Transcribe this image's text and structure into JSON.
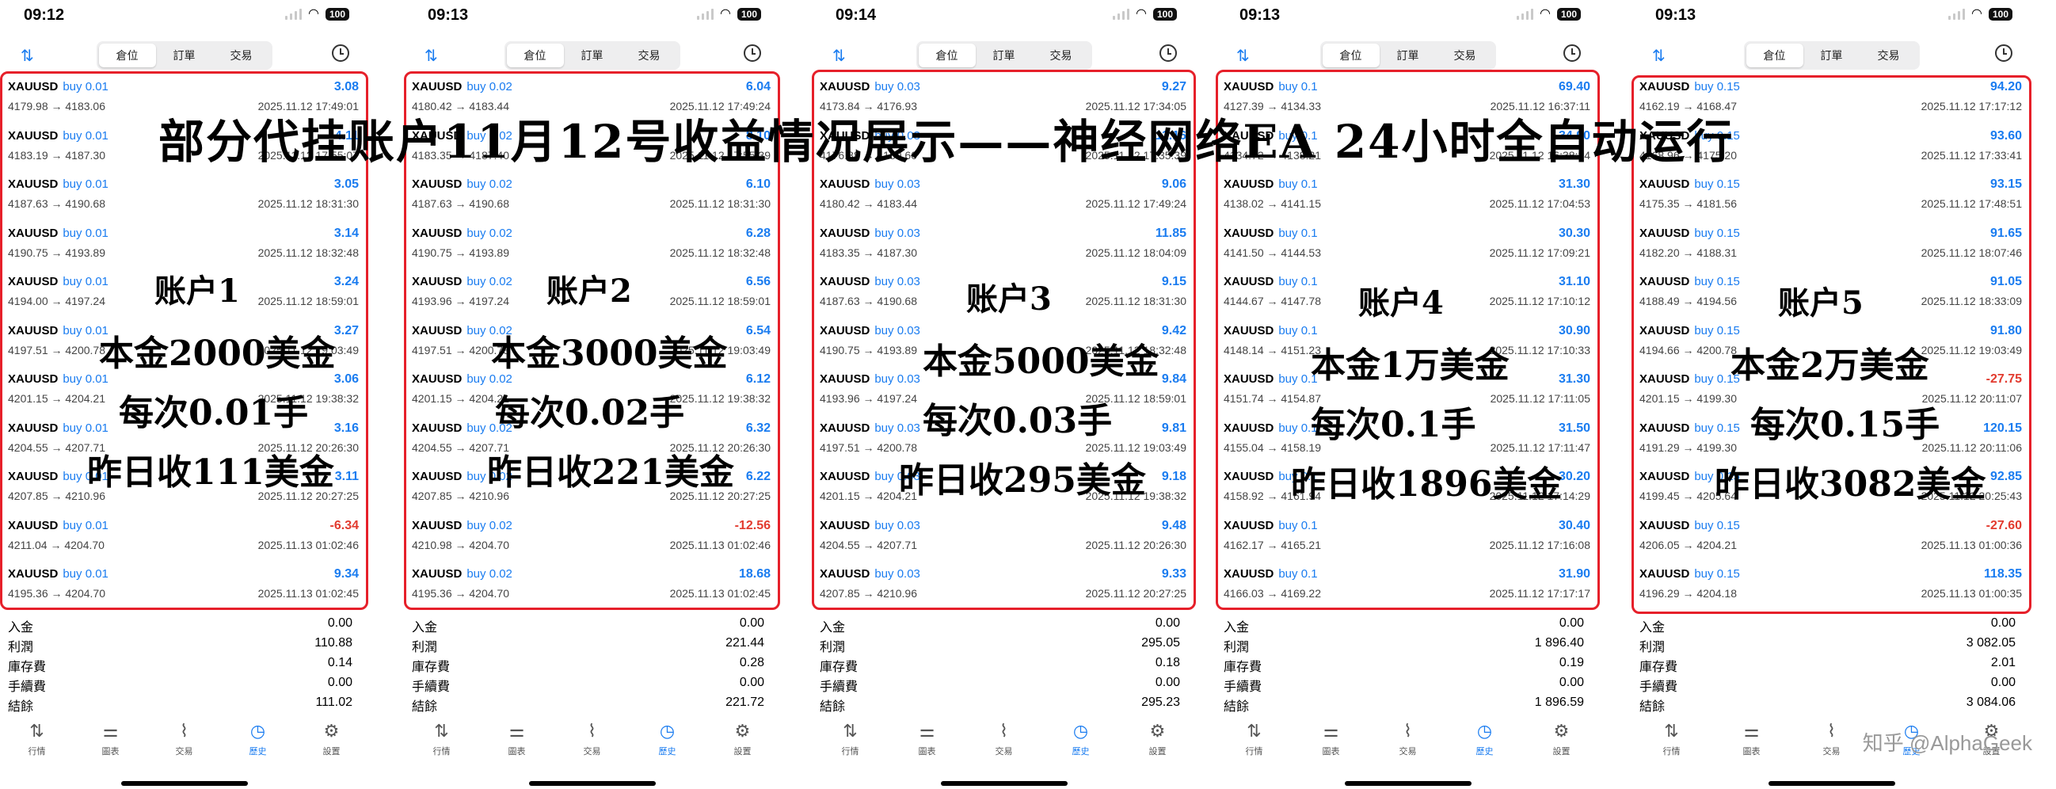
{
  "overlay_title": "部分代挂账户11月12号收益情况展示——神经网络EA 24小时全自动运行",
  "watermark": "知乎 @AlphaGeek",
  "segment_tabs": [
    "倉位",
    "訂單",
    "交易"
  ],
  "bottom_tabs": [
    {
      "label": "行情",
      "icon": "quotes-icon",
      "glyph": "⇅"
    },
    {
      "label": "圖表",
      "icon": "chart-icon",
      "glyph": "⚌"
    },
    {
      "label": "交易",
      "icon": "trade-icon",
      "glyph": "⌇"
    },
    {
      "label": "歷史",
      "icon": "history-icon",
      "glyph": "◷"
    },
    {
      "label": "設置",
      "icon": "settings-icon",
      "glyph": "⚙"
    }
  ],
  "summary_labels": {
    "deposit": "入金",
    "profit": "利潤",
    "swap": "庫存費",
    "commission": "手續費",
    "balance": "結餘"
  },
  "colors": {
    "buy": "#1a7cf0",
    "negative": "#e23b2f",
    "highlight": "#e6202a"
  },
  "screens": [
    {
      "time": "09:12",
      "battery": "100",
      "symbol": "XAUUSD",
      "side": "buy 0.01",
      "notes": {
        "account": "账户1",
        "capital": "本金2000美金",
        "lot": "每次0.01手",
        "yesterday": "昨日收111美金"
      },
      "trades": [
        {
          "price": "4179.98 → 4183.06",
          "profit": "3.08",
          "time": "2025.11.12 17:49:01"
        },
        {
          "price": "4183.19 → 4187.30",
          "profit": "4.11",
          "time": "2025.11.12 17:55:07"
        },
        {
          "price": "4187.63 → 4190.68",
          "profit": "3.05",
          "time": "2025.11.12 18:31:30"
        },
        {
          "price": "4190.75 → 4193.89",
          "profit": "3.14",
          "time": "2025.11.12 18:32:48"
        },
        {
          "price": "4194.00 → 4197.24",
          "profit": "3.24",
          "time": "2025.11.12 18:59:01"
        },
        {
          "price": "4197.51 → 4200.78",
          "profit": "3.27",
          "time": "2025.11.12 19:03:49"
        },
        {
          "price": "4201.15 → 4204.21",
          "profit": "3.06",
          "time": "2025.11.12 19:38:32"
        },
        {
          "price": "4204.55 → 4207.71",
          "profit": "3.16",
          "time": "2025.11.12 20:26:30"
        },
        {
          "price": "4207.85 → 4210.96",
          "profit": "3.11",
          "time": "2025.11.12 20:27:25"
        },
        {
          "price": "4211.04 → 4204.70",
          "profit": "-6.34",
          "time": "2025.11.13 01:02:46"
        },
        {
          "price": "4195.36 → 4204.70",
          "profit": "9.34",
          "time": "2025.11.13 01:02:45"
        }
      ],
      "summary": {
        "deposit": "0.00",
        "profit": "110.88",
        "swap": "0.14",
        "commission": "0.00",
        "balance": "111.02"
      }
    },
    {
      "time": "09:13",
      "battery": "100",
      "symbol": "XAUUSD",
      "side": "buy 0.02",
      "notes": {
        "account": "账户2",
        "capital": "本金3000美金",
        "lot": "每次0.02手",
        "yesterday": "昨日收221美金"
      },
      "trades": [
        {
          "price": "4180.42 → 4183.44",
          "profit": "6.04",
          "time": "2025.11.12 17:49:24"
        },
        {
          "price": "4183.35 → 4187.40",
          "profit": "8.10",
          "time": "2025.11.12 17:55:39"
        },
        {
          "price": "4187.63 → 4190.68",
          "profit": "6.10",
          "time": "2025.11.12 18:31:30"
        },
        {
          "price": "4190.75 → 4193.89",
          "profit": "6.28",
          "time": "2025.11.12 18:32:48"
        },
        {
          "price": "4193.96 → 4197.24",
          "profit": "6.56",
          "time": "2025.11.12 18:59:01"
        },
        {
          "price": "4197.51 → 4200.78",
          "profit": "6.54",
          "time": "2025.11.12 19:03:49"
        },
        {
          "price": "4201.15 → 4204.21",
          "profit": "6.12",
          "time": "2025.11.12 19:38:32"
        },
        {
          "price": "4204.55 → 4207.71",
          "profit": "6.32",
          "time": "2025.11.12 20:26:30"
        },
        {
          "price": "4207.85 → 4210.96",
          "profit": "6.22",
          "time": "2025.11.12 20:27:25"
        },
        {
          "price": "4210.98 → 4204.70",
          "profit": "-12.56",
          "time": "2025.11.13 01:02:46"
        },
        {
          "price": "4195.36 → 4204.70",
          "profit": "18.68",
          "time": "2025.11.13 01:02:45"
        }
      ],
      "summary": {
        "deposit": "0.00",
        "profit": "221.44",
        "swap": "0.28",
        "commission": "0.00",
        "balance": "221.72"
      }
    },
    {
      "time": "09:14",
      "battery": "100",
      "symbol": "XAUUSD",
      "side": "buy 0.03",
      "notes": {
        "account": "账户3",
        "capital": "本金5000美金",
        "lot": "每次0.03手",
        "yesterday": "昨日收295美金"
      },
      "trades": [
        {
          "price": "4173.84 → 4176.93",
          "profit": "9.27",
          "time": "2025.11.12 17:34:05"
        },
        {
          "price": "4176.88 → 4180.60",
          "profit": "11.16",
          "time": "2025.11.12 17:35:39"
        },
        {
          "price": "4180.42 → 4183.44",
          "profit": "9.06",
          "time": "2025.11.12 17:49:24"
        },
        {
          "price": "4183.35 → 4187.30",
          "profit": "11.85",
          "time": "2025.11.12 18:04:09"
        },
        {
          "price": "4187.63 → 4190.68",
          "profit": "9.15",
          "time": "2025.11.12 18:31:30"
        },
        {
          "price": "4190.75 → 4193.89",
          "profit": "9.42",
          "time": "2025.11.12 18:32:48"
        },
        {
          "price": "4193.96 → 4197.24",
          "profit": "9.84",
          "time": "2025.11.12 18:59:01"
        },
        {
          "price": "4197.51 → 4200.78",
          "profit": "9.81",
          "time": "2025.11.12 19:03:49"
        },
        {
          "price": "4201.15 → 4204.21",
          "profit": "9.18",
          "time": "2025.11.12 19:38:32"
        },
        {
          "price": "4204.55 → 4207.71",
          "profit": "9.48",
          "time": "2025.11.12 20:26:30"
        },
        {
          "price": "4207.85 → 4210.96",
          "profit": "9.33",
          "time": "2025.11.12 20:27:25"
        }
      ],
      "summary": {
        "deposit": "0.00",
        "profit": "295.05",
        "swap": "0.18",
        "commission": "0.00",
        "balance": "295.23"
      }
    },
    {
      "time": "09:13",
      "battery": "100",
      "symbol": "XAUUSD",
      "side": "buy 0.1",
      "notes": {
        "account": "账户4",
        "capital": "本金1万美金",
        "lot": "每次0.1手",
        "yesterday": "昨日收1896美金"
      },
      "trades": [
        {
          "price": "4127.39 → 4134.33",
          "profit": "69.40",
          "time": "2025.11.12 16:37:11"
        },
        {
          "price": "4134.72 → 4138.21",
          "profit": "34.90",
          "time": "2025.11.12 16:38:34"
        },
        {
          "price": "4138.02 → 4141.15",
          "profit": "31.30",
          "time": "2025.11.12 17:04:53"
        },
        {
          "price": "4141.50 → 4144.53",
          "profit": "30.30",
          "time": "2025.11.12 17:09:21"
        },
        {
          "price": "4144.67 → 4147.78",
          "profit": "31.10",
          "time": "2025.11.12 17:10:12"
        },
        {
          "price": "4148.14 → 4151.23",
          "profit": "30.90",
          "time": "2025.11.12 17:10:33"
        },
        {
          "price": "4151.74 → 4154.87",
          "profit": "31.30",
          "time": "2025.11.12 17:11:05"
        },
        {
          "price": "4155.04 → 4158.19",
          "profit": "31.50",
          "time": "2025.11.12 17:11:47"
        },
        {
          "price": "4158.92 → 4161.94",
          "profit": "30.20",
          "time": "2025.11.12 17:14:29"
        },
        {
          "price": "4162.17 → 4165.21",
          "profit": "30.40",
          "time": "2025.11.12 17:16:08"
        },
        {
          "price": "4166.03 → 4169.22",
          "profit": "31.90",
          "time": "2025.11.12 17:17:17"
        }
      ],
      "summary": {
        "deposit": "0.00",
        "profit": "1 896.40",
        "swap": "0.19",
        "commission": "0.00",
        "balance": "1 896.59"
      }
    },
    {
      "time": "09:13",
      "battery": "100",
      "symbol": "XAUUSD",
      "side": "buy 0.15",
      "notes": {
        "account": "账户5",
        "capital": "本金2万美金",
        "lot": "每次0.15手",
        "yesterday": "昨日收3082美金"
      },
      "trades": [
        {
          "price": "4162.19 → 4168.47",
          "profit": "94.20",
          "time": "2025.11.12 17:17:12"
        },
        {
          "price": "4168.96 → 4175.20",
          "profit": "93.60",
          "time": "2025.11.12 17:33:41"
        },
        {
          "price": "4175.35 → 4181.56",
          "profit": "93.15",
          "time": "2025.11.12 17:48:51"
        },
        {
          "price": "4182.20 → 4188.31",
          "profit": "91.65",
          "time": "2025.11.12 18:07:46"
        },
        {
          "price": "4188.49 → 4194.56",
          "profit": "91.05",
          "time": "2025.11.12 18:33:09"
        },
        {
          "price": "4194.66 → 4200.78",
          "profit": "91.80",
          "time": "2025.11.12 19:03:49"
        },
        {
          "price": "4201.15 → 4199.30",
          "profit": "-27.75",
          "time": "2025.11.12 20:11:07"
        },
        {
          "price": "4191.29 → 4199.30",
          "profit": "120.15",
          "time": "2025.11.12 20:11:06"
        },
        {
          "price": "4199.45 → 4205.64",
          "profit": "92.85",
          "time": "2025.11.12 20:25:43"
        },
        {
          "price": "4206.05 → 4204.21",
          "profit": "-27.60",
          "time": "2025.11.13 01:00:36"
        },
        {
          "price": "4196.29 → 4204.18",
          "profit": "118.35",
          "time": "2025.11.13 01:00:35"
        }
      ],
      "summary": {
        "deposit": "0.00",
        "profit": "3 082.05",
        "swap": "2.01",
        "commission": "0.00",
        "balance": "3 084.06"
      }
    }
  ]
}
